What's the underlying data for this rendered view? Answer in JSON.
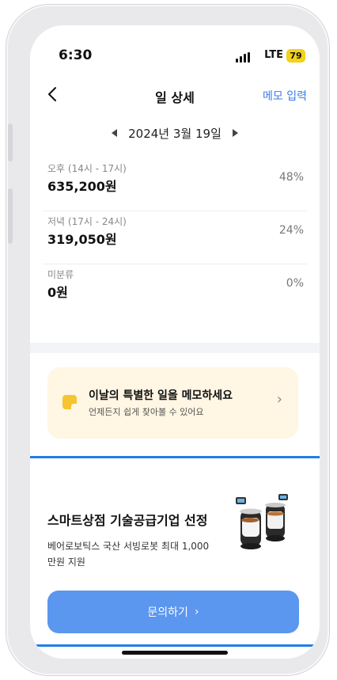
{
  "status": {
    "time": "6:30",
    "network": "LTE",
    "battery": "79"
  },
  "nav": {
    "title": "일 상세",
    "right_link": "메모 입력"
  },
  "date": {
    "label": "2024년 3월 19일"
  },
  "breakdown": [
    {
      "label": "오후 (14시 - 17시)",
      "amount": "635,200원",
      "percent": "48%"
    },
    {
      "label": "저녁 (17시 - 24시)",
      "amount": "319,050원",
      "percent": "24%"
    },
    {
      "label": "미분류",
      "amount": "0원",
      "percent": "0%"
    }
  ],
  "memo_card": {
    "title": "이날의 특별한 일을 메모하세요",
    "subtitle": "언제든지 쉽게 찾아볼 수 있어요"
  },
  "promo": {
    "title": "스마트상점 기술공급기업 선정",
    "description": "베어로보틱스 국산 서빙로봇 최대 1,000 만원 지원",
    "button": "문의하기"
  },
  "colors": {
    "accent": "#3a7bea",
    "button": "#5b96ef",
    "highlight_border": "#1f7fe6",
    "memo_bg": "#fff6e3",
    "battery": "#f2d21a"
  },
  "icons": [
    "back-arrow-icon",
    "prev-date-icon",
    "next-date-icon",
    "memo-note-icon",
    "chevron-right-icon",
    "serving-robot-image"
  ]
}
